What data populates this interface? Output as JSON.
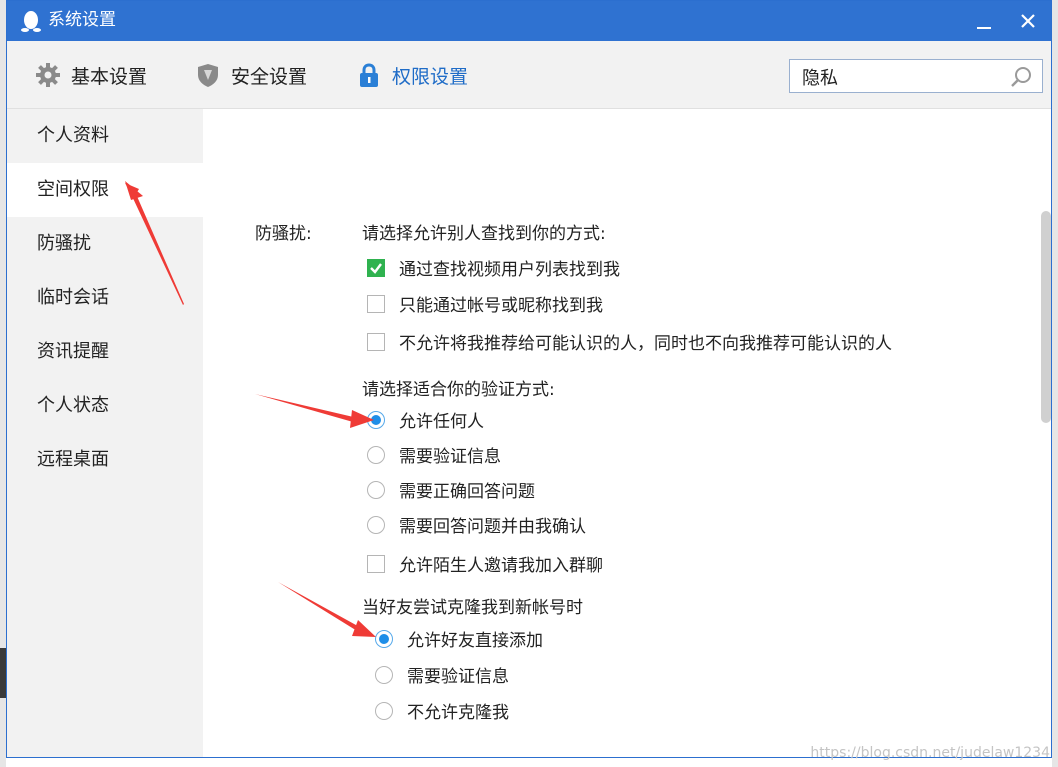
{
  "window": {
    "title": "系统设置",
    "minimize_icon": "minimize-icon",
    "close_icon": "close-icon",
    "accent": "#2f72d1"
  },
  "toolbar": {
    "tabs": [
      {
        "label": "基本设置",
        "icon": "gear-icon"
      },
      {
        "label": "安全设置",
        "icon": "shield-icon"
      },
      {
        "label": "权限设置",
        "icon": "lock-icon",
        "active": true
      }
    ],
    "search": {
      "value": "隐私",
      "icon": "search-icon"
    }
  },
  "sidebar": {
    "items": [
      {
        "label": "个人资料"
      },
      {
        "label": "空间权限",
        "active": true
      },
      {
        "label": "防骚扰"
      },
      {
        "label": "临时会话"
      },
      {
        "label": "资讯提醒"
      },
      {
        "label": "个人状态"
      },
      {
        "label": "远程桌面"
      }
    ]
  },
  "content": {
    "section_label": "防骚扰:",
    "find_question": "请选择允许别人查找到你的方式:",
    "find_options": [
      {
        "label": "通过查找视频用户列表找到我",
        "checked": true
      },
      {
        "label": "只能通过帐号或昵称找到我",
        "checked": false
      },
      {
        "label": "不允许将我推荐给可能认识的人，同时也不向我推荐可能认识的人",
        "checked": false
      }
    ],
    "verify_question": "请选择适合你的验证方式:",
    "verify_options": [
      {
        "label": "允许任何人",
        "selected": true
      },
      {
        "label": "需要验证信息",
        "selected": false
      },
      {
        "label": "需要正确回答问题",
        "selected": false
      },
      {
        "label": "需要回答问题并由我确认",
        "selected": false
      }
    ],
    "group_invite": {
      "label": "允许陌生人邀请我加入群聊",
      "checked": false
    },
    "clone_question": "当好友尝试克隆我到新帐号时",
    "clone_options": [
      {
        "label": "允许好友直接添加",
        "selected": true
      },
      {
        "label": "需要验证信息",
        "selected": false
      },
      {
        "label": "不允许克隆我",
        "selected": false
      }
    ]
  },
  "watermark": "https://blog.csdn.net/judelaw1234",
  "colors": {
    "check_green": "#2fb24f",
    "radio_blue": "#1e8ee8",
    "annotation_red": "#ef3b36"
  }
}
